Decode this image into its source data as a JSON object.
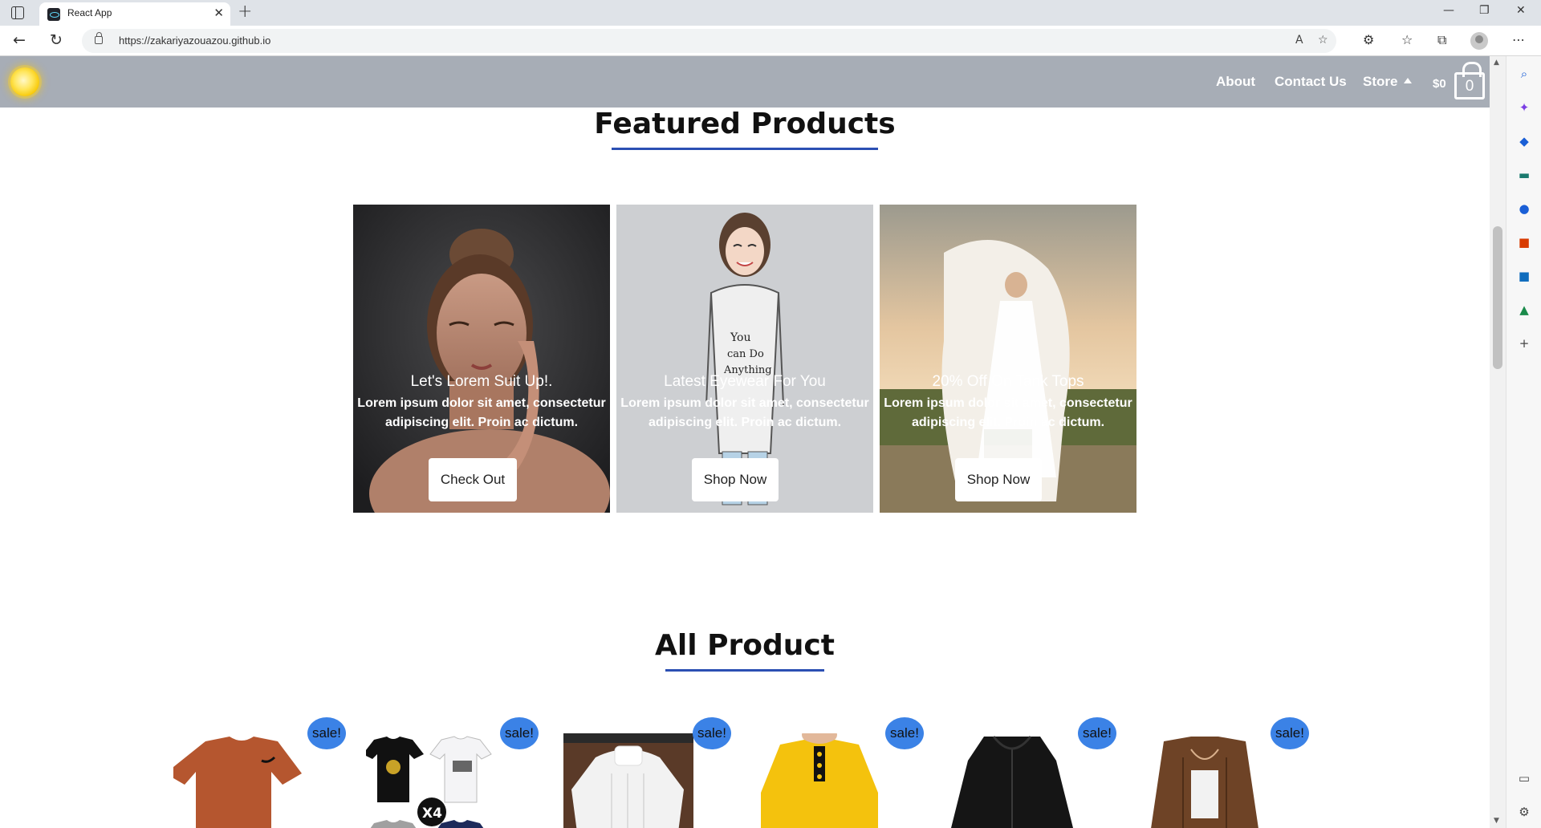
{
  "browser": {
    "tab_title": "React App",
    "url": "https://zakariyazouazou.github.io"
  },
  "header": {
    "nav": [
      {
        "label": "About"
      },
      {
        "label": "Contact Us"
      },
      {
        "label": "Store"
      }
    ],
    "cart_total": "$0",
    "cart_count": "0"
  },
  "featured": {
    "title": "Featured Products",
    "cards": [
      {
        "heading": "Let's Lorem Suit Up!.",
        "text": "Lorem ipsum dolor sit amet, consectetur adipiscing elit. Proin ac dictum.",
        "button": "Check Out"
      },
      {
        "heading": "Latest Eyewear For You",
        "text": "Lorem ipsum dolor sit amet, consectetur adipiscing elit. Proin ac dictum.",
        "button": "Shop Now",
        "shirt_text": "You can Do Anything"
      },
      {
        "heading": "20% Off On Tank Tops",
        "text": "Lorem ipsum dolor sit amet, consectetur adipiscing elit. Proin ac dictum.",
        "button": "Shop Now"
      }
    ]
  },
  "all_products": {
    "title": "All Product",
    "badge": "sale!",
    "bundle_label": "X4"
  },
  "colors": {
    "header_bg": "#a7adb6",
    "underline": "#2b4fb3",
    "sale_badge": "#3b82e6"
  }
}
